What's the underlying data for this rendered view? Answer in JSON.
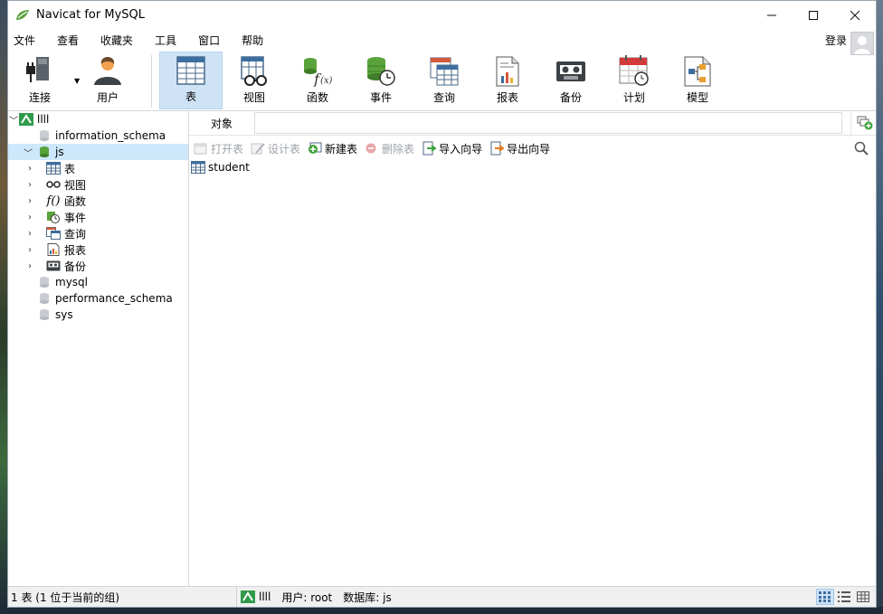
{
  "window": {
    "title": "Navicat for MySQL"
  },
  "menu": [
    "文件",
    "查看",
    "收藏夹",
    "工具",
    "窗口",
    "帮助"
  ],
  "login_label": "登录",
  "toolbar": [
    {
      "label": "连接",
      "icon": "connection-plug-icon"
    },
    {
      "label": "用户",
      "icon": "user-icon"
    },
    {
      "label": "表",
      "icon": "table-icon",
      "active": true
    },
    {
      "label": "视图",
      "icon": "view-glasses-icon"
    },
    {
      "label": "函数",
      "icon": "function-icon"
    },
    {
      "label": "事件",
      "icon": "event-clock-icon"
    },
    {
      "label": "查询",
      "icon": "query-icon"
    },
    {
      "label": "报表",
      "icon": "report-icon"
    },
    {
      "label": "备份",
      "icon": "backup-icon"
    },
    {
      "label": "计划",
      "icon": "schedule-calendar-icon"
    },
    {
      "label": "模型",
      "icon": "model-icon"
    }
  ],
  "tree": {
    "connection": "llll",
    "databases": [
      "information_schema",
      "js",
      "mysql",
      "performance_schema",
      "sys"
    ],
    "js_children": [
      "表",
      "视图",
      "函数",
      "事件",
      "查询",
      "报表",
      "备份"
    ]
  },
  "objects_tab": "对象",
  "actions": [
    {
      "label": "打开表",
      "enabled": false
    },
    {
      "label": "设计表",
      "enabled": false
    },
    {
      "label": "新建表",
      "enabled": true
    },
    {
      "label": "删除表",
      "enabled": false
    },
    {
      "label": "导入向导",
      "enabled": true
    },
    {
      "label": "导出向导",
      "enabled": true
    }
  ],
  "object_list": [
    "student"
  ],
  "status": {
    "count": "1 表 (1 位于当前的组)",
    "connection": "llll",
    "user": "用户: root",
    "database": "数据库: js"
  },
  "colors": {
    "accent": "#cfe3f6",
    "selected": "#cde8fb"
  }
}
